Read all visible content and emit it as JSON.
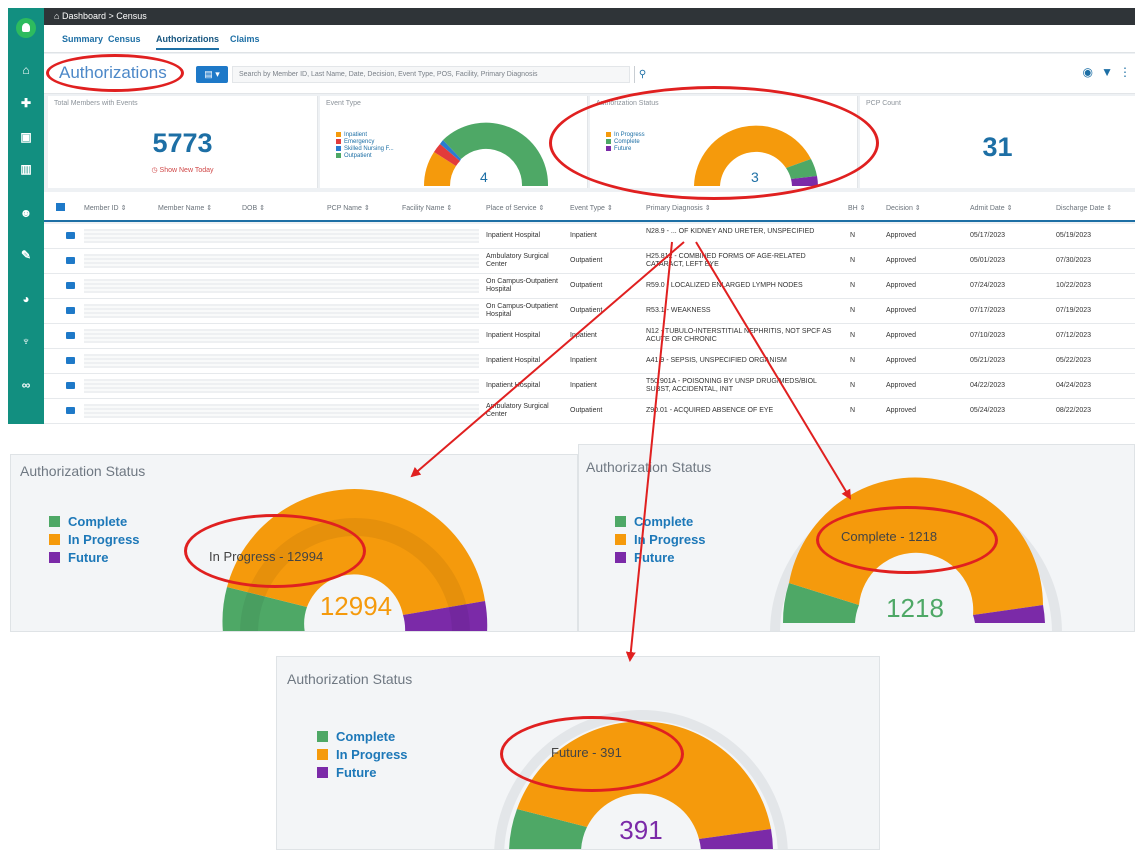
{
  "breadcrumb": {
    "home_icon": "home-icon",
    "dashboard": "Dashboard",
    "sep": ">",
    "census": "Census"
  },
  "tabs": [
    "Summary",
    "Census",
    "Authorizations",
    "Claims"
  ],
  "page_title": "Authorizations",
  "search": {
    "placeholder": "Search by Member ID, Last Name, Date, Decision, Event Type, POS, Facility, Primary Diagnosis"
  },
  "cards": {
    "members": {
      "title": "Total Members with Events",
      "value": "5773",
      "link": "Show New Today"
    },
    "event_type": {
      "title": "Event Type",
      "legend": [
        "Inpatient",
        "Emergency",
        "Skilled Nursing F...",
        "Outpatient"
      ],
      "value": "4"
    },
    "auth_status": {
      "title": "Authorization Status",
      "legend": [
        "In Progress",
        "Complete",
        "Future"
      ],
      "value": "3"
    },
    "pcp": {
      "title": "PCP Count",
      "value": "31"
    }
  },
  "columns": [
    "Member ID",
    "Member Name",
    "DOB",
    "PCP Name",
    "Facility Name",
    "Place of Service",
    "Event Type",
    "Primary Diagnosis",
    "BH",
    "Decision",
    "Admit Date",
    "Discharge Date"
  ],
  "rows": [
    {
      "pos": "Inpatient Hospital",
      "event": "Inpatient",
      "dx": "N28.9 - ... OF KIDNEY AND URETER, UNSPECIFIED",
      "bh": "N",
      "decision": "Approved",
      "admit": "05/17/2023",
      "discharge": "05/19/2023"
    },
    {
      "pos": "Ambulatory Surgical Center",
      "event": "Outpatient",
      "dx": "H25.812 - COMBINED FORMS OF AGE-RELATED CATARACT, LEFT EYE",
      "bh": "N",
      "decision": "Approved",
      "admit": "05/01/2023",
      "discharge": "07/30/2023"
    },
    {
      "pos": "On Campus-Outpatient Hospital",
      "event": "Outpatient",
      "dx": "R59.0 - LOCALIZED ENLARGED LYMPH NODES",
      "bh": "N",
      "decision": "Approved",
      "admit": "07/24/2023",
      "discharge": "10/22/2023"
    },
    {
      "pos": "On Campus-Outpatient Hospital",
      "event": "Outpatient",
      "dx": "R53.1 - WEAKNESS",
      "bh": "N",
      "decision": "Approved",
      "admit": "07/17/2023",
      "discharge": "07/19/2023"
    },
    {
      "pos": "Inpatient Hospital",
      "event": "Inpatient",
      "dx": "N12 - TUBULO-INTERSTITIAL NEPHRITIS, NOT SPCF AS ACUTE OR CHRONIC",
      "bh": "N",
      "decision": "Approved",
      "admit": "07/10/2023",
      "discharge": "07/12/2023"
    },
    {
      "pos": "Inpatient Hospital",
      "event": "Inpatient",
      "dx": "A41.9 - SEPSIS, UNSPECIFIED ORGANISM",
      "bh": "N",
      "decision": "Approved",
      "admit": "05/21/2023",
      "discharge": "05/22/2023"
    },
    {
      "pos": "Inpatient Hospital",
      "event": "Inpatient",
      "dx": "T50.901A - POISONING BY UNSP DRUG/MEDS/BIOL SUBST, ACCIDENTAL, INIT",
      "bh": "N",
      "decision": "Approved",
      "admit": "04/22/2023",
      "discharge": "04/24/2023"
    },
    {
      "pos": "Ambulatory Surgical Center",
      "event": "Outpatient",
      "dx": "Z90.01 - ACQUIRED ABSENCE OF EYE",
      "bh": "N",
      "decision": "Approved",
      "admit": "05/24/2023",
      "discharge": "08/22/2023"
    }
  ],
  "zoom_panels": [
    {
      "title": "Authorization Status",
      "legend": [
        "Complete",
        "In Progress",
        "Future"
      ],
      "tooltip": "In Progress - 12994",
      "value": "12994",
      "value_color": "#f59a0c"
    },
    {
      "title": "Authorization Status",
      "legend": [
        "Complete",
        "In Progress",
        "Future"
      ],
      "tooltip": "Complete - 1218",
      "value": "1218",
      "value_color": "#4ea866"
    },
    {
      "title": "Authorization Status",
      "legend": [
        "Complete",
        "In Progress",
        "Future"
      ],
      "tooltip": "Future - 391",
      "value": "391",
      "value_color": "#7b2aa8"
    }
  ],
  "chart_data": {
    "type": "pie",
    "title": "Authorization Status",
    "categories": [
      "Complete",
      "In Progress",
      "Future"
    ],
    "values": [
      1218,
      12994,
      391
    ],
    "colors": [
      "#4ea866",
      "#f59a0c",
      "#7b2aa8"
    ]
  },
  "colors": {
    "teal": "#128f80",
    "accent": "#1d6fa5",
    "complete": "#4ea866",
    "in_progress": "#f59a0c",
    "future": "#7b2aa8",
    "annotation": "#e02020"
  }
}
